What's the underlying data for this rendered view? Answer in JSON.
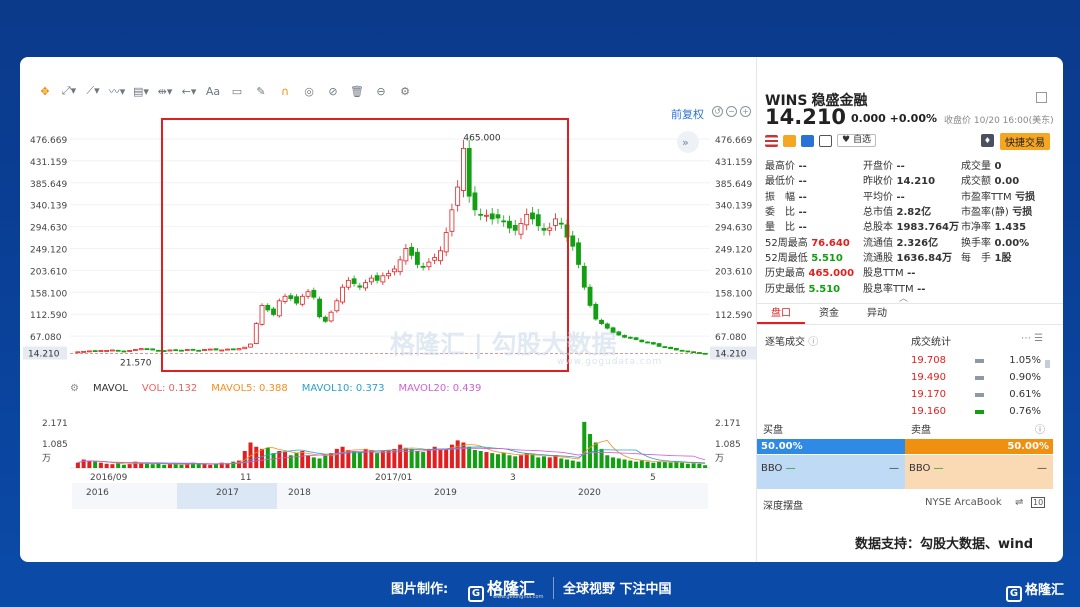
{
  "toolbar": {
    "icons": [
      "move-icon",
      "line-icon",
      "channel-icon",
      "wave-icon",
      "fib-icon",
      "range-icon",
      "arrow-icon",
      "text-icon",
      "comment-icon",
      "pencil-icon",
      "magnet-icon",
      "eye-off-icon",
      "lock-icon",
      "trash-icon",
      "compare-icon",
      "gear-icon"
    ],
    "text_tool_label": "Aa",
    "restore_label": "前复权"
  },
  "price_axis": [
    "476.669",
    "431.159",
    "385.649",
    "340.139",
    "294.630",
    "249.120",
    "203.610",
    "158.100",
    "112.590",
    "67.080",
    "14.210"
  ],
  "last_price_label": "14.210",
  "min_label": "21.570",
  "max_label": "465.000",
  "vol_legend": {
    "name": "MAVOL",
    "vol": "VOL: 0.132",
    "mavol5": "MAVOL5: 0.388",
    "mavol10": "MAVOL10: 0.373",
    "mavol20": "MAVOL20: 0.439",
    "colors": {
      "vol": "#e86060",
      "mavol5": "#f09020",
      "mavol10": "#2aa0d0",
      "mavol20": "#d060d0"
    }
  },
  "vol_axis": [
    "2.171",
    "1.085",
    "万"
  ],
  "time_axis": [
    "2016/09",
    "11",
    "2017/01",
    "3",
    "5"
  ],
  "nav_axis": [
    "2016",
    "2017",
    "2018",
    "2019",
    "2020"
  ],
  "chart_data": {
    "type": "candlestick",
    "ylim": [
      0,
      490
    ],
    "x": [
      "2016/09",
      "11",
      "2017/01",
      "3",
      "5"
    ],
    "close": [
      18,
      19,
      20,
      19,
      21,
      21,
      22,
      20,
      19,
      21,
      23,
      25,
      24,
      22,
      21,
      20,
      22,
      22,
      21,
      23,
      22,
      21,
      23,
      24,
      22,
      22,
      24,
      23,
      25,
      28,
      35,
      80,
      120,
      110,
      100,
      130,
      140,
      135,
      125,
      140,
      150,
      138,
      95,
      85,
      105,
      130,
      160,
      175,
      168,
      160,
      170,
      180,
      175,
      185,
      190,
      200,
      220,
      245,
      230,
      210,
      205,
      215,
      225,
      240,
      280,
      330,
      380,
      465,
      360,
      330,
      320,
      318,
      310,
      312,
      305,
      290,
      285,
      300,
      320,
      310,
      295,
      285,
      290,
      310,
      300,
      270,
      250,
      210,
      160,
      120,
      90,
      80,
      70,
      60,
      55,
      50,
      48,
      45,
      40,
      38,
      35,
      30,
      28,
      25,
      22,
      20,
      18,
      16,
      15,
      14.21
    ],
    "volume": [
      0.25,
      0.4,
      0.35,
      0.3,
      0.25,
      0.2,
      0.18,
      0.22,
      0.15,
      0.2,
      0.3,
      0.25,
      0.2,
      0.18,
      0.22,
      0.15,
      0.2,
      0.18,
      0.15,
      0.2,
      0.25,
      0.2,
      0.18,
      0.15,
      0.2,
      0.25,
      0.22,
      0.3,
      0.35,
      0.8,
      1.2,
      1.0,
      0.9,
      0.95,
      0.7,
      0.8,
      0.75,
      0.6,
      0.7,
      0.8,
      0.6,
      0.5,
      0.45,
      0.6,
      0.7,
      0.9,
      1.0,
      0.85,
      0.8,
      0.75,
      0.9,
      0.85,
      0.7,
      0.8,
      0.85,
      0.9,
      1.1,
      0.95,
      0.9,
      0.8,
      0.75,
      0.9,
      1.0,
      0.85,
      0.9,
      1.1,
      1.3,
      1.2,
      1.0,
      0.85,
      0.8,
      0.75,
      0.7,
      0.65,
      0.7,
      0.6,
      0.55,
      0.6,
      0.7,
      0.65,
      0.5,
      0.55,
      0.5,
      0.6,
      0.45,
      0.4,
      0.35,
      0.3,
      2.171,
      1.6,
      1.2,
      0.9,
      0.6,
      0.5,
      0.45,
      0.4,
      0.35,
      0.3,
      0.35,
      0.3,
      0.25,
      0.3,
      0.28,
      0.25,
      0.3,
      0.25,
      0.2,
      0.22,
      0.2,
      0.132
    ]
  },
  "quote": {
    "symbol": "WINS",
    "name": "稳盛金融",
    "price": "14.210",
    "change": "0.000 +0.00%",
    "time": "收盘价 10/20 16:00(美东)",
    "watch_label": "自选",
    "fast_trade_label": "快捷交易",
    "rows": [
      [
        {
          "l": "最高价",
          "v": "--"
        },
        {
          "l": "开盘价",
          "v": "--"
        },
        {
          "l": "成交量",
          "v": "0"
        }
      ],
      [
        {
          "l": "最低价",
          "v": "--"
        },
        {
          "l": "昨收价",
          "v": "14.210"
        },
        {
          "l": "成交额",
          "v": "0.00"
        }
      ],
      [
        {
          "l": "振　幅",
          "v": "--"
        },
        {
          "l": "平均价",
          "v": "--"
        },
        {
          "l": "市盈率TTM",
          "v": "亏损"
        }
      ],
      [
        {
          "l": "委　比",
          "v": "--"
        },
        {
          "l": "总市值",
          "v": "2.82亿"
        },
        {
          "l": "市盈率(静)",
          "v": "亏损"
        }
      ],
      [
        {
          "l": "量　比",
          "v": "--"
        },
        {
          "l": "总股本",
          "v": "1983.764万"
        },
        {
          "l": "市净率",
          "v": "1.435"
        }
      ],
      [
        {
          "l": "52周最高",
          "v": "76.640"
        },
        {
          "l": "流通值",
          "v": "2.326亿"
        },
        {
          "l": "换手率",
          "v": "0.00%"
        }
      ],
      [
        {
          "l": "52周最低",
          "v": "5.510"
        },
        {
          "l": "流通股",
          "v": "1636.84万"
        },
        {
          "l": "每　手",
          "v": "1股"
        }
      ],
      [
        {
          "l": "历史最高",
          "v": "465.000"
        },
        {
          "l": "股息TTM",
          "v": "--"
        },
        {
          "l": "",
          "v": ""
        }
      ],
      [
        {
          "l": "历史最低",
          "v": "5.510"
        },
        {
          "l": "股息率TTM",
          "v": "--"
        },
        {
          "l": "",
          "v": ""
        }
      ]
    ],
    "tabs": [
      "盘口",
      "资金",
      "异动"
    ],
    "trades_label": "逐笔成交",
    "stats_label": "成交统计",
    "trades": [
      {
        "price": "19.708",
        "pct": "1.05%"
      },
      {
        "price": "19.490",
        "pct": "0.90%"
      },
      {
        "price": "19.170",
        "pct": "0.61%"
      },
      {
        "price": "19.160",
        "pct": "0.76%"
      }
    ],
    "buy_label": "买盘",
    "sell_label": "卖盘",
    "buy_pct": "50.00%",
    "sell_pct": "50.00%",
    "bbo_label": "BBO",
    "bbo_dash": "—",
    "depth_label": "深度摆盘",
    "book_label": "NYSE ArcaBook"
  },
  "source_note": "数据支持：勾股大数据、wind",
  "watermark": {
    "main": "格隆汇 | 勾股大数据",
    "sub": "www.gogudata.com"
  },
  "footer": {
    "made_by": "图片制作:",
    "logo": "格隆汇",
    "logo_sub": "www.gelonghui.com",
    "slogan": "全球视野 下注中国",
    "corner": "格隆汇"
  }
}
